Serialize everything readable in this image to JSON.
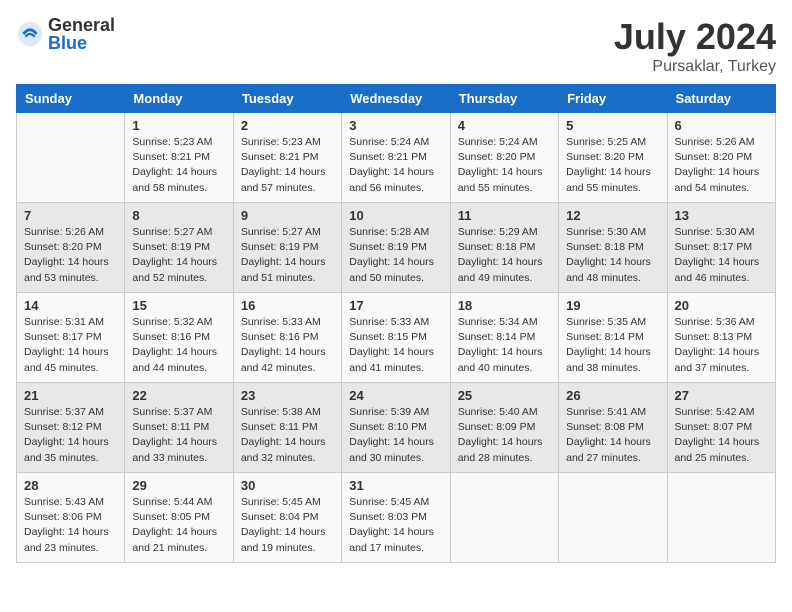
{
  "header": {
    "logo_general": "General",
    "logo_blue": "Blue",
    "title": "July 2024",
    "subtitle": "Pursaklar, Turkey"
  },
  "columns": [
    "Sunday",
    "Monday",
    "Tuesday",
    "Wednesday",
    "Thursday",
    "Friday",
    "Saturday"
  ],
  "weeks": [
    [
      {
        "day": "",
        "info": ""
      },
      {
        "day": "1",
        "info": "Sunrise: 5:23 AM\nSunset: 8:21 PM\nDaylight: 14 hours\nand 58 minutes."
      },
      {
        "day": "2",
        "info": "Sunrise: 5:23 AM\nSunset: 8:21 PM\nDaylight: 14 hours\nand 57 minutes."
      },
      {
        "day": "3",
        "info": "Sunrise: 5:24 AM\nSunset: 8:21 PM\nDaylight: 14 hours\nand 56 minutes."
      },
      {
        "day": "4",
        "info": "Sunrise: 5:24 AM\nSunset: 8:20 PM\nDaylight: 14 hours\nand 55 minutes."
      },
      {
        "day": "5",
        "info": "Sunrise: 5:25 AM\nSunset: 8:20 PM\nDaylight: 14 hours\nand 55 minutes."
      },
      {
        "day": "6",
        "info": "Sunrise: 5:26 AM\nSunset: 8:20 PM\nDaylight: 14 hours\nand 54 minutes."
      }
    ],
    [
      {
        "day": "7",
        "info": "Sunrise: 5:26 AM\nSunset: 8:20 PM\nDaylight: 14 hours\nand 53 minutes."
      },
      {
        "day": "8",
        "info": "Sunrise: 5:27 AM\nSunset: 8:19 PM\nDaylight: 14 hours\nand 52 minutes."
      },
      {
        "day": "9",
        "info": "Sunrise: 5:27 AM\nSunset: 8:19 PM\nDaylight: 14 hours\nand 51 minutes."
      },
      {
        "day": "10",
        "info": "Sunrise: 5:28 AM\nSunset: 8:19 PM\nDaylight: 14 hours\nand 50 minutes."
      },
      {
        "day": "11",
        "info": "Sunrise: 5:29 AM\nSunset: 8:18 PM\nDaylight: 14 hours\nand 49 minutes."
      },
      {
        "day": "12",
        "info": "Sunrise: 5:30 AM\nSunset: 8:18 PM\nDaylight: 14 hours\nand 48 minutes."
      },
      {
        "day": "13",
        "info": "Sunrise: 5:30 AM\nSunset: 8:17 PM\nDaylight: 14 hours\nand 46 minutes."
      }
    ],
    [
      {
        "day": "14",
        "info": "Sunrise: 5:31 AM\nSunset: 8:17 PM\nDaylight: 14 hours\nand 45 minutes."
      },
      {
        "day": "15",
        "info": "Sunrise: 5:32 AM\nSunset: 8:16 PM\nDaylight: 14 hours\nand 44 minutes."
      },
      {
        "day": "16",
        "info": "Sunrise: 5:33 AM\nSunset: 8:16 PM\nDaylight: 14 hours\nand 42 minutes."
      },
      {
        "day": "17",
        "info": "Sunrise: 5:33 AM\nSunset: 8:15 PM\nDaylight: 14 hours\nand 41 minutes."
      },
      {
        "day": "18",
        "info": "Sunrise: 5:34 AM\nSunset: 8:14 PM\nDaylight: 14 hours\nand 40 minutes."
      },
      {
        "day": "19",
        "info": "Sunrise: 5:35 AM\nSunset: 8:14 PM\nDaylight: 14 hours\nand 38 minutes."
      },
      {
        "day": "20",
        "info": "Sunrise: 5:36 AM\nSunset: 8:13 PM\nDaylight: 14 hours\nand 37 minutes."
      }
    ],
    [
      {
        "day": "21",
        "info": "Sunrise: 5:37 AM\nSunset: 8:12 PM\nDaylight: 14 hours\nand 35 minutes."
      },
      {
        "day": "22",
        "info": "Sunrise: 5:37 AM\nSunset: 8:11 PM\nDaylight: 14 hours\nand 33 minutes."
      },
      {
        "day": "23",
        "info": "Sunrise: 5:38 AM\nSunset: 8:11 PM\nDaylight: 14 hours\nand 32 minutes."
      },
      {
        "day": "24",
        "info": "Sunrise: 5:39 AM\nSunset: 8:10 PM\nDaylight: 14 hours\nand 30 minutes."
      },
      {
        "day": "25",
        "info": "Sunrise: 5:40 AM\nSunset: 8:09 PM\nDaylight: 14 hours\nand 28 minutes."
      },
      {
        "day": "26",
        "info": "Sunrise: 5:41 AM\nSunset: 8:08 PM\nDaylight: 14 hours\nand 27 minutes."
      },
      {
        "day": "27",
        "info": "Sunrise: 5:42 AM\nSunset: 8:07 PM\nDaylight: 14 hours\nand 25 minutes."
      }
    ],
    [
      {
        "day": "28",
        "info": "Sunrise: 5:43 AM\nSunset: 8:06 PM\nDaylight: 14 hours\nand 23 minutes."
      },
      {
        "day": "29",
        "info": "Sunrise: 5:44 AM\nSunset: 8:05 PM\nDaylight: 14 hours\nand 21 minutes."
      },
      {
        "day": "30",
        "info": "Sunrise: 5:45 AM\nSunset: 8:04 PM\nDaylight: 14 hours\nand 19 minutes."
      },
      {
        "day": "31",
        "info": "Sunrise: 5:45 AM\nSunset: 8:03 PM\nDaylight: 14 hours\nand 17 minutes."
      },
      {
        "day": "",
        "info": ""
      },
      {
        "day": "",
        "info": ""
      },
      {
        "day": "",
        "info": ""
      }
    ]
  ]
}
